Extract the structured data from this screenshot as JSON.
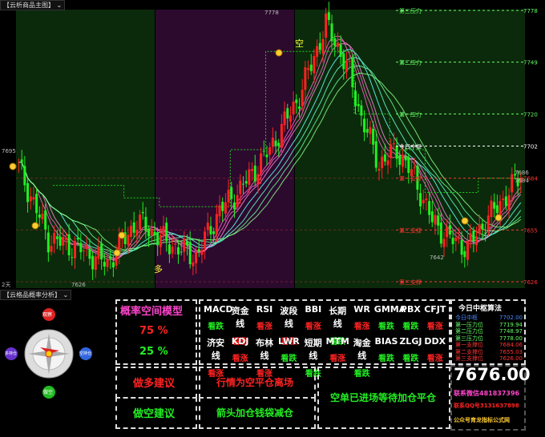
{
  "main_panel": {
    "title": "【云析商品主图】"
  },
  "sub_panel": {
    "title": "【云格品概率分析】"
  },
  "chart_data": {
    "type": "candlestick",
    "y_range": [
      7626,
      7778
    ],
    "price_labels": {
      "high": "7778",
      "low_left": "7626",
      "low_mid": "7642",
      "left_value": "7695",
      "right_a": "7686",
      "right_b": "7684",
      "bottom_left": "2天"
    },
    "markers": {
      "kong": "空",
      "duo": "多"
    },
    "levels": [
      {
        "name": "第三压力",
        "value": "7778",
        "color": "#66ff66"
      },
      {
        "name": "第二压力",
        "value": "7749",
        "color": "#66ff66"
      },
      {
        "name": "第一压力",
        "value": "7720",
        "color": "#66ff66"
      },
      {
        "name": "今日中枢",
        "value": "7702",
        "color": "#ffffff"
      },
      {
        "name": "第一支撑",
        "value": "7684",
        "color": "#ff3333"
      },
      {
        "name": "第二支撑",
        "value": "7655",
        "color": "#ff3333"
      },
      {
        "name": "第三支撑",
        "value": "7626",
        "color": "#ff3333"
      }
    ]
  },
  "compass": {
    "top": "观察",
    "left": "多持仓",
    "right": "空持仓",
    "bottom": "做空"
  },
  "model": {
    "title": "概率空间模型",
    "up_pct": "75 %",
    "down_pct": "25 %"
  },
  "indicators_row1": [
    {
      "name": "MACD",
      "signal": "看跌"
    },
    {
      "name": "资金线",
      "signal": "看涨"
    },
    {
      "name": "RSI",
      "signal": "看涨"
    },
    {
      "name": "波段线",
      "signal": "看涨"
    },
    {
      "name": "BBI",
      "signal": "看涨"
    },
    {
      "name": "长期线",
      "signal": "看跌"
    },
    {
      "name": "WR",
      "signal": "看涨"
    },
    {
      "name": "GMMA",
      "signal": "看跌"
    },
    {
      "name": "PBX",
      "signal": "看跌"
    },
    {
      "name": "CFJT",
      "signal": "看涨"
    }
  ],
  "indicators_row2": [
    {
      "name": "济安线",
      "signal": "看涨"
    },
    {
      "name": "KDJ",
      "signal": "看涨"
    },
    {
      "name": "布林线",
      "signal": "看涨"
    },
    {
      "name": "LWR",
      "signal": "看跌"
    },
    {
      "name": "短期线",
      "signal": "看跌"
    },
    {
      "name": "MTM",
      "signal": "看涨"
    },
    {
      "name": "淘金线",
      "signal": "看跌"
    },
    {
      "name": "BIAS",
      "signal": "看跌"
    },
    {
      "name": "ZLGJ",
      "signal": "看跌"
    },
    {
      "name": "DDX",
      "signal": "看涨"
    }
  ],
  "advice": {
    "long_label": "做多建议",
    "short_label": "做空建议",
    "long_text": "行情为空平仓离场",
    "short_text": "箭头加仓钱袋减仓",
    "status_text": "空单已进场等待加仓平仓"
  },
  "pivot": {
    "title": "今日中枢算法",
    "rows": [
      {
        "label": "今日中枢",
        "value": "7702.00",
        "color": "#4a8bff"
      },
      {
        "label": "第一压力位",
        "value": "7719.94",
        "color": "#66ff66"
      },
      {
        "label": "第二压力位",
        "value": "7748.97",
        "color": "#66ff66"
      },
      {
        "label": "第三压力位",
        "value": "7778.00",
        "color": "#66ff66"
      },
      {
        "label": "第一支撑位",
        "value": "7684.06",
        "color": "#ff3333"
      },
      {
        "label": "第二支撑位",
        "value": "7655.03",
        "color": "#ff3333"
      },
      {
        "label": "第三支撑位",
        "value": "7626.00",
        "color": "#ff3333"
      }
    ],
    "current_price": "7676.00",
    "contact_wechat": "联系微信481837396",
    "contact_qq": "联系QQ号3131637898",
    "footer": "公众号育龙指标公式网"
  },
  "colors": {
    "up": "#ff2222",
    "down": "#22ee22",
    "bg_green": "#0b2a0b",
    "bg_purple": "#2c0a2e"
  }
}
